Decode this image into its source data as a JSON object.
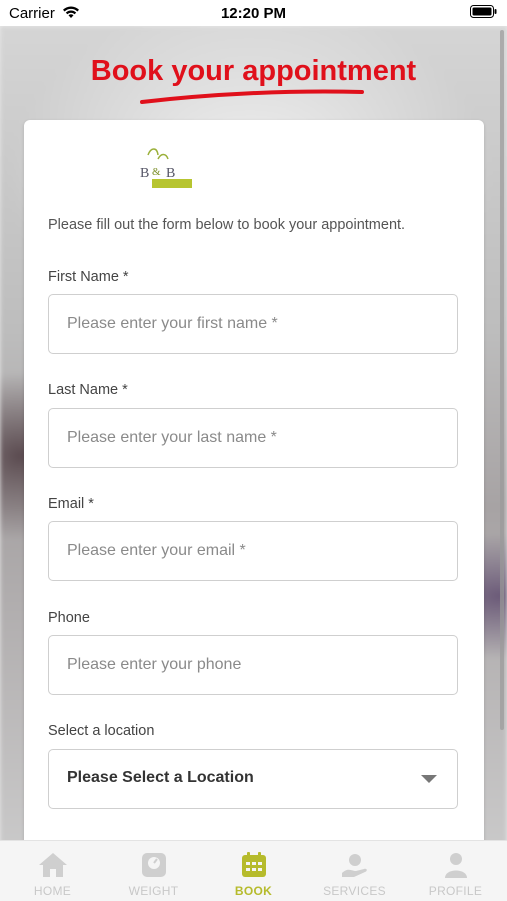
{
  "status_bar": {
    "carrier": "Carrier",
    "time": "12:20 PM"
  },
  "header": {
    "title": "Book your appointment"
  },
  "form": {
    "intro": "Please fill out the form below to book your appointment.",
    "first_name": {
      "label": "First Name *",
      "placeholder": "Please enter your first name *"
    },
    "last_name": {
      "label": "Last Name *",
      "placeholder": "Please enter your last name *"
    },
    "email": {
      "label": "Email *",
      "placeholder": "Please enter your email *"
    },
    "phone": {
      "label": "Phone",
      "placeholder": "Please enter your phone"
    },
    "location": {
      "label": "Select a location",
      "selected": "Please Select a Location"
    }
  },
  "tabs": [
    {
      "label": "HOME",
      "icon": "home-icon"
    },
    {
      "label": "WEIGHT",
      "icon": "scale-icon"
    },
    {
      "label": "BOOK",
      "icon": "calendar-icon"
    },
    {
      "label": "SERVICES",
      "icon": "services-icon"
    },
    {
      "label": "PROFILE",
      "icon": "profile-icon"
    }
  ],
  "colors": {
    "title_red": "#e0101b",
    "active_tab": "#b6bb2c",
    "inactive_tab": "#c8c8c8"
  }
}
